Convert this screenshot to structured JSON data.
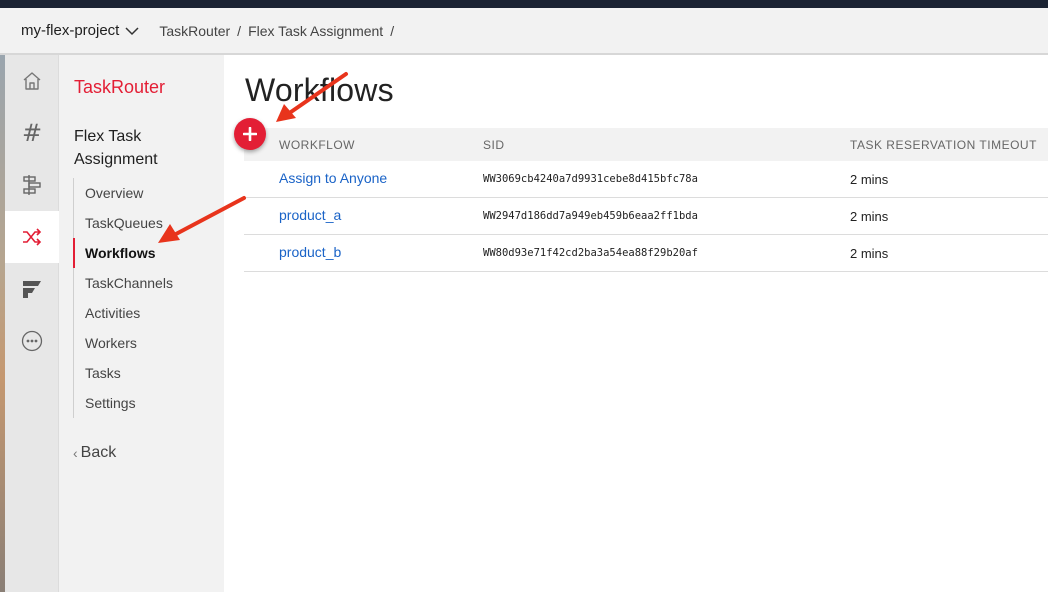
{
  "header": {
    "project": "my-flex-project",
    "breadcrumbs": [
      "TaskRouter",
      "Flex Task Assignment"
    ],
    "separator": "/"
  },
  "rail": {
    "icons": [
      "home-icon",
      "hash-icon",
      "routing-icon",
      "shuffle-icon",
      "flex-logo-icon",
      "more-icon"
    ],
    "active": "shuffle-icon",
    "hash_glyph": "#"
  },
  "subnav": {
    "title": "TaskRouter",
    "group": "Flex Task Assignment",
    "items": [
      {
        "label": "Overview"
      },
      {
        "label": "TaskQueues"
      },
      {
        "label": "Workflows"
      },
      {
        "label": "TaskChannels"
      },
      {
        "label": "Activities"
      },
      {
        "label": "Workers"
      },
      {
        "label": "Tasks"
      },
      {
        "label": "Settings"
      }
    ],
    "active": "Workflows",
    "back": "Back",
    "back_glyph": "‹"
  },
  "main": {
    "title": "Workflows",
    "columns": {
      "workflow": "WORKFLOW",
      "sid": "SID",
      "timeout": "TASK RESERVATION TIMEOUT"
    },
    "rows": [
      {
        "workflow": "Assign to Anyone",
        "sid": "WW3069cb4240a7d9931cebe8d415bfc78a",
        "timeout": "2 mins"
      },
      {
        "workflow": "product_a",
        "sid": "WW2947d186dd7a949eb459b6eaa2ff1bda",
        "timeout": "2 mins"
      },
      {
        "workflow": "product_b",
        "sid": "WW80d93e71f42cd2ba3a54ea88f29b20af",
        "timeout": "2 mins"
      }
    ]
  },
  "colors": {
    "accent": "#e31e35",
    "link": "#1a63c7",
    "annotation_arrow": "#e8341c"
  }
}
